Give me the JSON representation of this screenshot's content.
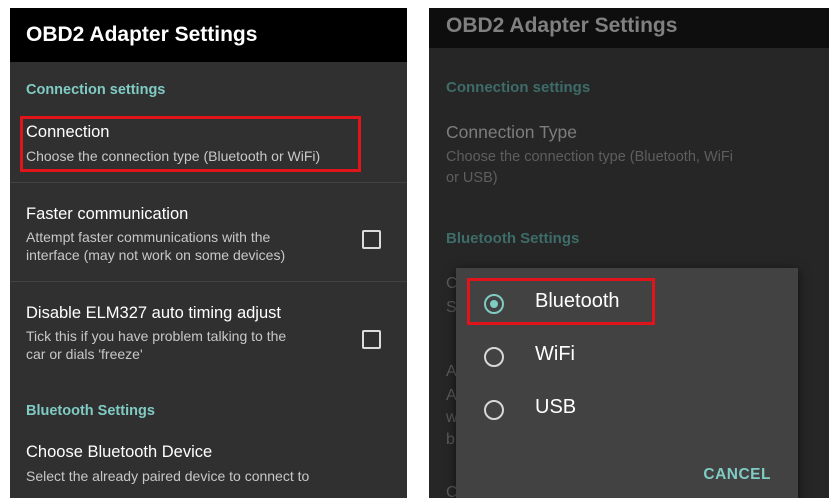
{
  "left": {
    "title": "OBD2 Adapter Settings",
    "category_connection": "Connection settings",
    "connection": {
      "title": "Connection",
      "summary": "Choose the connection type (Bluetooth or WiFi)"
    },
    "faster": {
      "title": "Faster communication",
      "summary_1": "Attempt faster communications with the",
      "summary_2": "interface (may not work on some devices)",
      "checked": false
    },
    "timing": {
      "title": "Disable ELM327 auto timing adjust",
      "summary_1": "Tick this if you have problem talking to the",
      "summary_2": "car or dials 'freeze'",
      "checked": false
    },
    "category_bluetooth": "Bluetooth Settings",
    "bt_device": {
      "title": "Choose Bluetooth Device",
      "summary": "Select the already paired device to connect to"
    }
  },
  "right": {
    "title": "OBD2 Adapter Settings",
    "category_connection": "Connection settings",
    "connection_type": {
      "title": "Connection Type",
      "summary_1": "Choose the connection type (Bluetooth, WiFi",
      "summary_2": "or USB)"
    },
    "category_bluetooth": "Bluetooth Settings",
    "peek": {
      "c": "C",
      "s": "S",
      "a": "A",
      "a2": "A",
      "w": "w",
      "b": "b",
      "c2": "C"
    },
    "dialog": {
      "options": [
        {
          "label": "Bluetooth",
          "selected": true
        },
        {
          "label": "WiFi",
          "selected": false
        },
        {
          "label": "USB",
          "selected": false
        }
      ],
      "cancel_label": "CANCEL"
    }
  },
  "colors": {
    "accent": "#80cbc4",
    "highlight": "#e0151b",
    "background": "#303030",
    "appbar": "#000000"
  }
}
